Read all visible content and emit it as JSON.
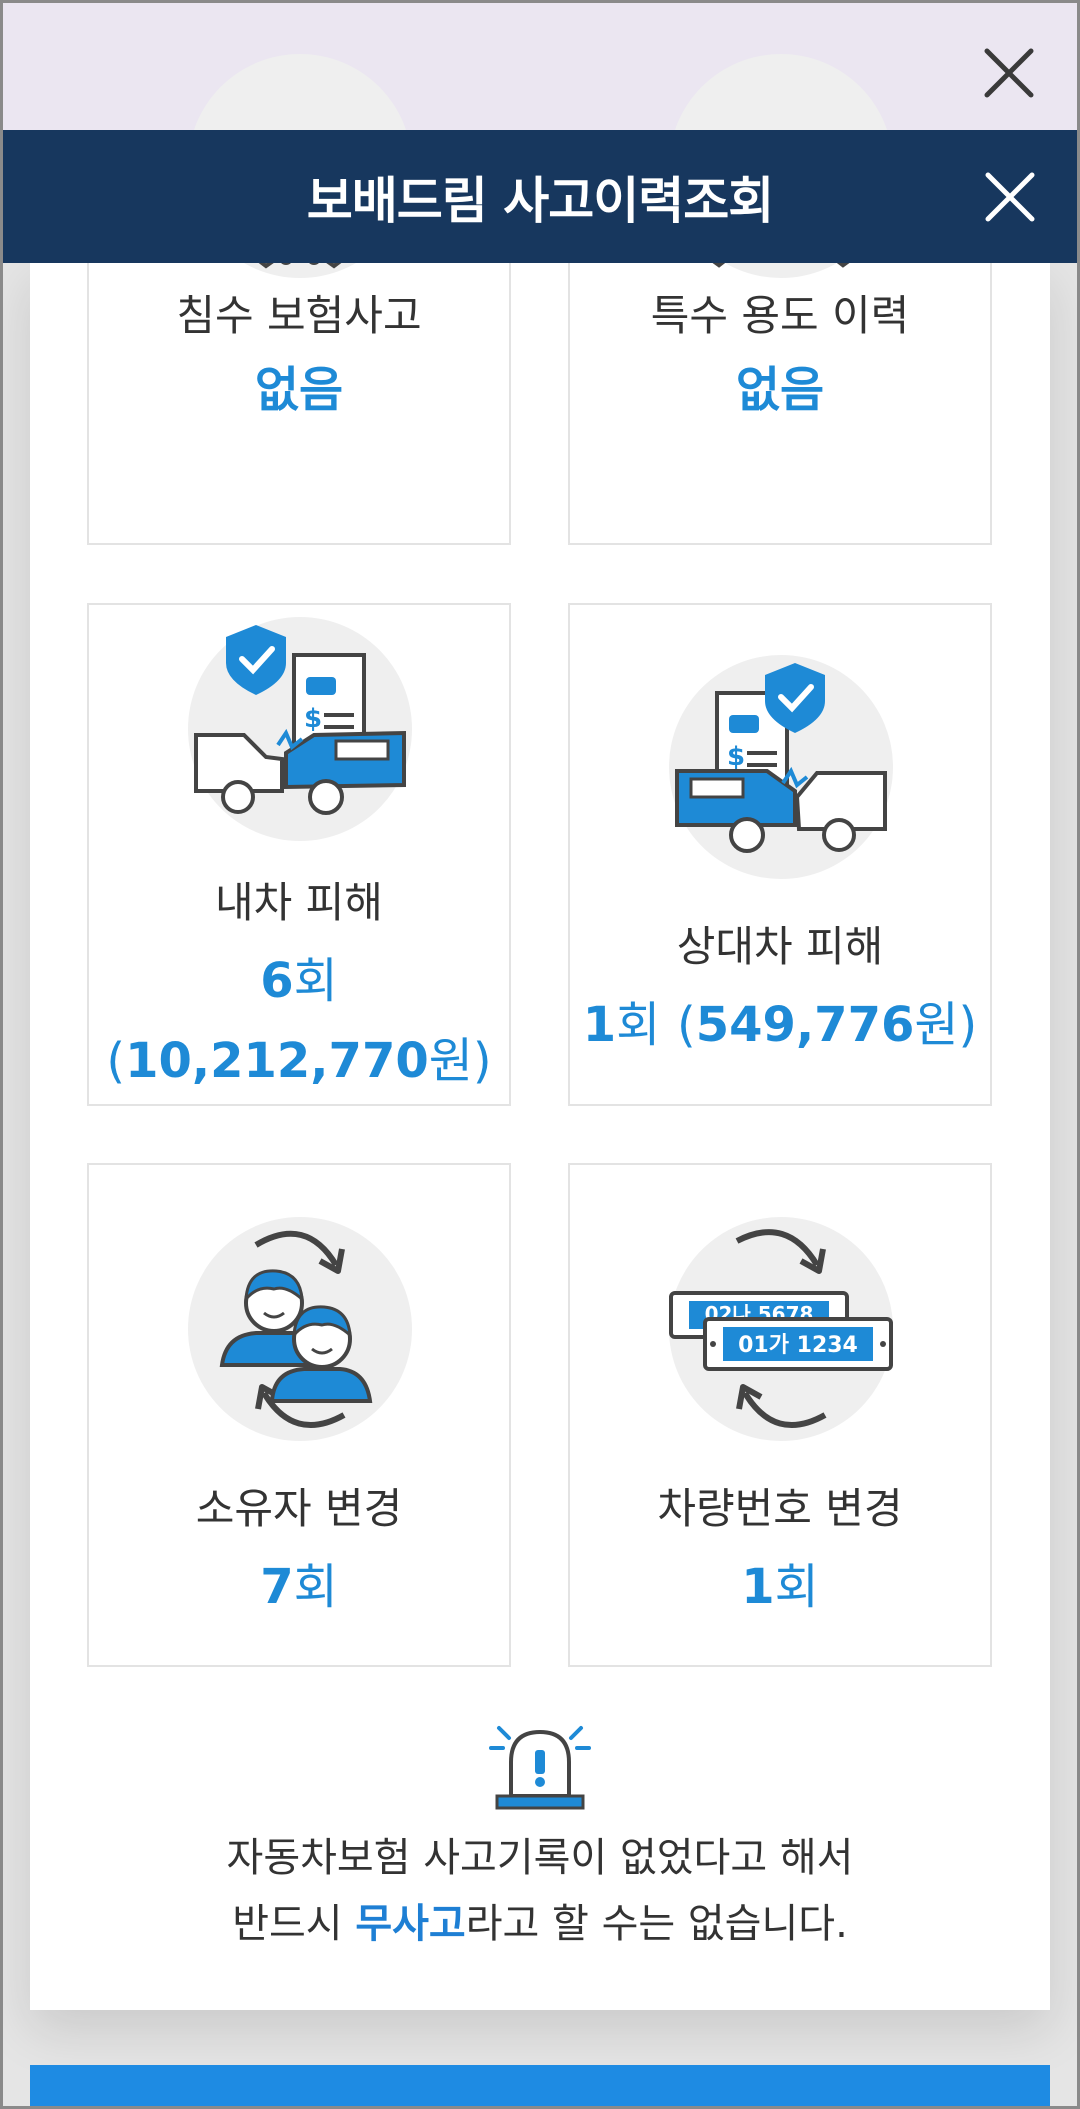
{
  "header": {
    "title": "보배드림 사고이력조회"
  },
  "cards": [
    {
      "label": "침수 보험사고",
      "value": "없음"
    },
    {
      "label": "특수 용도 이력",
      "value": "없음"
    },
    {
      "label": "내차 피해",
      "count": "6",
      "count_unit": "회",
      "amount_open": "(",
      "amount": "10,212,770",
      "amount_unit": "원",
      "amount_close": ")"
    },
    {
      "label": "상대차 피해",
      "count": "1",
      "count_unit": "회",
      "amount_open": "(",
      "amount": "549,776",
      "amount_unit": "원",
      "amount_close": ")"
    },
    {
      "label": "소유자 변경",
      "count": "7",
      "count_unit": "회"
    },
    {
      "label": "차량번호 변경",
      "count": "1",
      "count_unit": "회",
      "plate_back": "02나 5678",
      "plate_front": "01가 1234"
    }
  ],
  "notice": {
    "line1": "자동차보험 사고기록이 없었다고 해서",
    "line2_before": "반드시 ",
    "line2_highlight": "무사고",
    "line2_after": "라고 할 수는 없습니다."
  },
  "colors": {
    "accent": "#1e8ad6",
    "header_bg": "#17375e",
    "button": "#1e8be3"
  }
}
